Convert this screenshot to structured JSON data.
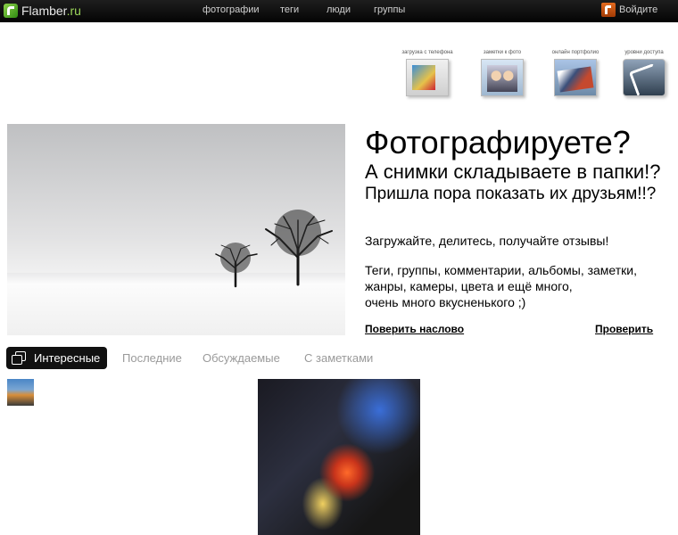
{
  "header": {
    "logo_name": "Flamber",
    "logo_tld": ".ru",
    "nav": [
      {
        "label": "фотографии"
      },
      {
        "label": "теги"
      },
      {
        "label": "люди"
      },
      {
        "label": "группы"
      }
    ],
    "login_label": "Войдите"
  },
  "features": [
    {
      "label": "загрузка с телефона",
      "icon": "phone-upload-icon"
    },
    {
      "label": "заметки к фото",
      "icon": "photo-notes-icon"
    },
    {
      "label": "онлайн портфолио",
      "icon": "portfolio-icon"
    },
    {
      "label": "уровни доступа",
      "icon": "access-levels-icon"
    }
  ],
  "hero": {
    "line1": "Фотографируете?",
    "line2": "А снимки складываете в папки!?",
    "line3": "Пришла пора показать их друзьям!!?",
    "tagline": "Загружайте, делитесь, получайте отзывы!",
    "features_lines": [
      "Теги, группы, комментарии, альбомы, заметки,",
      "жанры, камеры, цвета и ещё много,",
      "очень много вкусненького ;)"
    ],
    "link_trust": "Поверить наслово",
    "link_check": "Проверить"
  },
  "tabs": [
    {
      "label": "Интересные",
      "active": true
    },
    {
      "label": "Последние",
      "active": false
    },
    {
      "label": "Обсуждаемые",
      "active": false
    },
    {
      "label": "С заметками",
      "active": false
    }
  ],
  "colors": {
    "topbar": "#0a0a0a",
    "accent_green": "#9bd55a",
    "tab_active_bg": "#111111",
    "tab_inactive_text": "#9a9a9a"
  }
}
